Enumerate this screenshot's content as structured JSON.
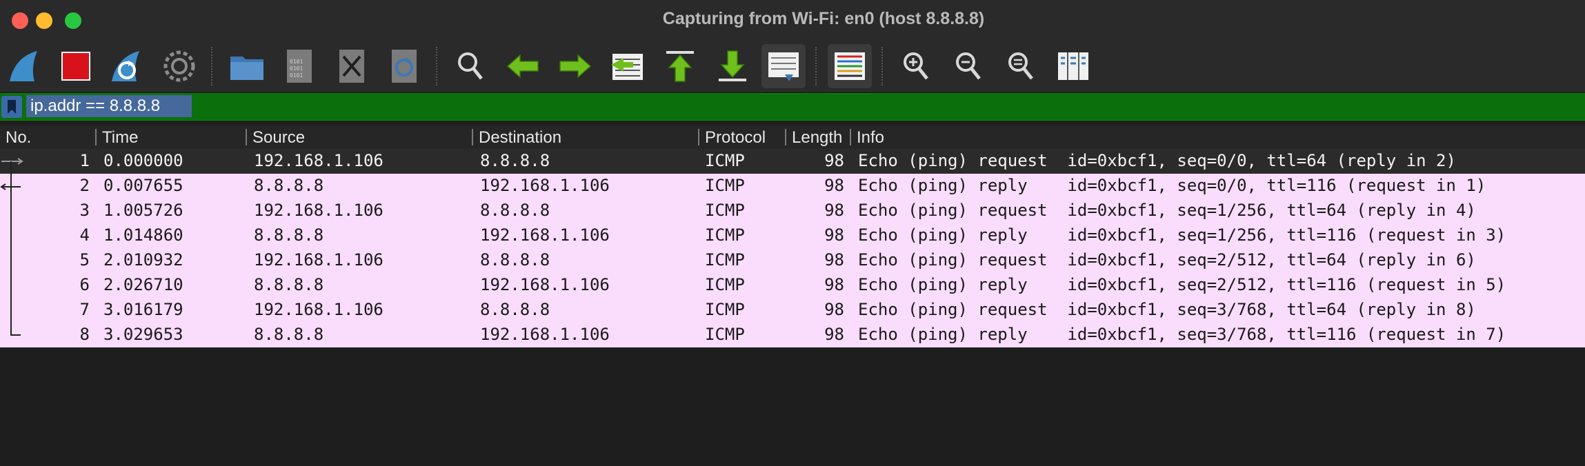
{
  "window": {
    "title": "Capturing from Wi-Fi: en0 (host 8.8.8.8)"
  },
  "toolbar": {
    "buttons": [
      {
        "name": "start-capture-button",
        "icon": "shark-fin-icon"
      },
      {
        "name": "stop-capture-button",
        "icon": "red-square-icon"
      },
      {
        "name": "restart-capture-button",
        "icon": "shark-fin-restart-icon"
      },
      {
        "name": "capture-options-button",
        "icon": "gear-icon"
      },
      {
        "name": "open-file-button",
        "icon": "folder-icon"
      },
      {
        "name": "save-file-button",
        "icon": "file-binary-icon"
      },
      {
        "name": "close-file-button",
        "icon": "file-close-icon"
      },
      {
        "name": "reload-file-button",
        "icon": "file-reload-icon"
      },
      {
        "name": "find-packet-button",
        "icon": "magnifier-icon"
      },
      {
        "name": "go-back-button",
        "icon": "arrow-left-icon"
      },
      {
        "name": "go-forward-button",
        "icon": "arrow-right-icon"
      },
      {
        "name": "go-to-packet-button",
        "icon": "goto-packet-icon"
      },
      {
        "name": "first-packet-button",
        "icon": "arrow-top-icon"
      },
      {
        "name": "last-packet-button",
        "icon": "arrow-bottom-icon"
      },
      {
        "name": "auto-scroll-button",
        "icon": "auto-scroll-icon"
      },
      {
        "name": "colorize-button",
        "icon": "colorize-lines-icon"
      },
      {
        "name": "zoom-in-button",
        "icon": "zoom-in-icon"
      },
      {
        "name": "zoom-out-button",
        "icon": "zoom-out-icon"
      },
      {
        "name": "normal-size-button",
        "icon": "zoom-normal-icon"
      },
      {
        "name": "resize-columns-button",
        "icon": "resize-columns-icon"
      }
    ]
  },
  "filter": {
    "value": "ip.addr == 8.8.8.8",
    "bar_color": "#0b6f0b"
  },
  "packet_list": {
    "columns": [
      "No.",
      "Time",
      "Source",
      "Destination",
      "Protocol",
      "Length",
      "Info"
    ],
    "rows": [
      {
        "no": "1",
        "time": "0.000000",
        "source": "192.168.1.106",
        "destination": "8.8.8.8",
        "protocol": "ICMP",
        "length": "98",
        "info": "Echo (ping) request  id=0xbcf1, seq=0/0, ttl=64 (reply in 2)"
      },
      {
        "no": "2",
        "time": "0.007655",
        "source": "8.8.8.8",
        "destination": "192.168.1.106",
        "protocol": "ICMP",
        "length": "98",
        "info": "Echo (ping) reply    id=0xbcf1, seq=0/0, ttl=116 (request in 1)"
      },
      {
        "no": "3",
        "time": "1.005726",
        "source": "192.168.1.106",
        "destination": "8.8.8.8",
        "protocol": "ICMP",
        "length": "98",
        "info": "Echo (ping) request  id=0xbcf1, seq=1/256, ttl=64 (reply in 4)"
      },
      {
        "no": "4",
        "time": "1.014860",
        "source": "8.8.8.8",
        "destination": "192.168.1.106",
        "protocol": "ICMP",
        "length": "98",
        "info": "Echo (ping) reply    id=0xbcf1, seq=1/256, ttl=116 (request in 3)"
      },
      {
        "no": "5",
        "time": "2.010932",
        "source": "192.168.1.106",
        "destination": "8.8.8.8",
        "protocol": "ICMP",
        "length": "98",
        "info": "Echo (ping) request  id=0xbcf1, seq=2/512, ttl=64 (reply in 6)"
      },
      {
        "no": "6",
        "time": "2.026710",
        "source": "8.8.8.8",
        "destination": "192.168.1.106",
        "protocol": "ICMP",
        "length": "98",
        "info": "Echo (ping) reply    id=0xbcf1, seq=2/512, ttl=116 (request in 5)"
      },
      {
        "no": "7",
        "time": "3.016179",
        "source": "192.168.1.106",
        "destination": "8.8.8.8",
        "protocol": "ICMP",
        "length": "98",
        "info": "Echo (ping) request  id=0xbcf1, seq=3/768, ttl=64 (reply in 8)"
      },
      {
        "no": "8",
        "time": "3.029653",
        "source": "8.8.8.8",
        "destination": "192.168.1.106",
        "protocol": "ICMP",
        "length": "98",
        "info": "Echo (ping) reply    id=0xbcf1, seq=3/768, ttl=116 (request in 7)"
      }
    ],
    "selected_row": 0,
    "row_color": "#fadcfc",
    "selected_color": "#2b2b2b"
  }
}
